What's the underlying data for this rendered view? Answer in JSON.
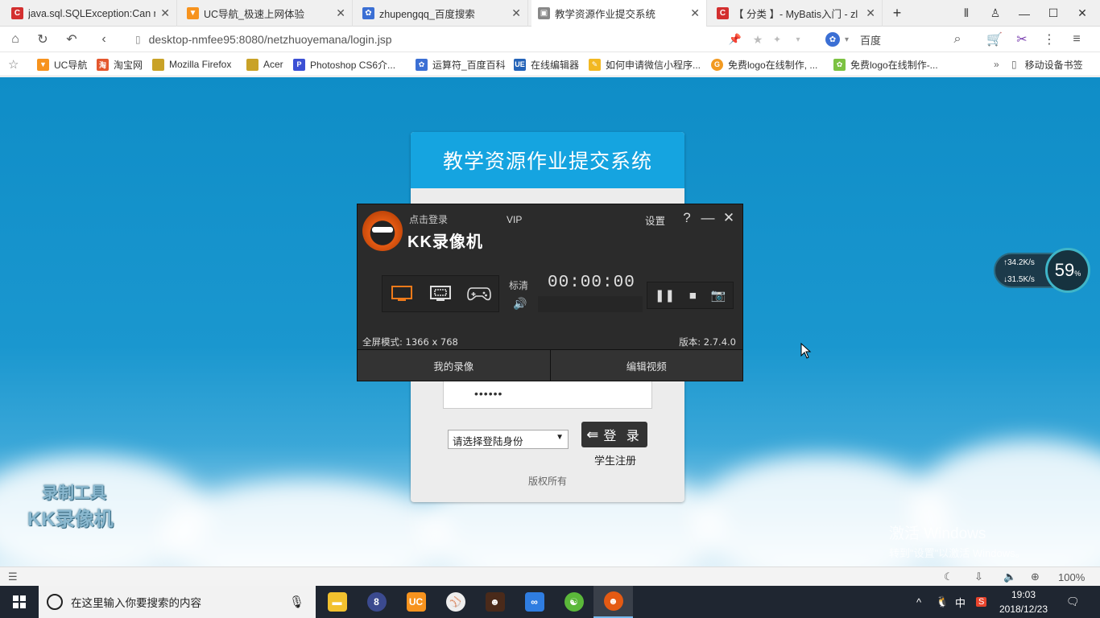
{
  "browser": {
    "tabs": [
      {
        "label": "java.sql.SQLException:Can n",
        "icon": "c-icon",
        "color": "#d32f2f"
      },
      {
        "label": "UC导航_极速上网体验",
        "icon": "uc-icon",
        "color": "#f7931e"
      },
      {
        "label": "zhupengqq_百度搜索",
        "icon": "baidu-paw-icon",
        "color": "#3b6fd4"
      },
      {
        "label": "教学资源作业提交系统",
        "icon": "page-icon",
        "color": "#888888"
      },
      {
        "label": "【 分类 】- MyBatis入门 - zl",
        "icon": "c-icon",
        "color": "#d32f2f"
      }
    ],
    "url": "desktop-nmfee95:8080/netzhuoyemana/login.jsp",
    "search_engine": "百度",
    "bookmarks": [
      {
        "label": "UC导航",
        "color": "#f7931e"
      },
      {
        "label": "淘宝网",
        "color": "#e4572e"
      },
      {
        "label": "Mozilla Firefox",
        "color": "#c9a227"
      },
      {
        "label": "Acer",
        "color": "#c9a227"
      },
      {
        "label": "Photoshop CS6介...",
        "color": "#3b4fd4"
      },
      {
        "label": "运算符_百度百科",
        "color": "#3b6fd4"
      },
      {
        "label": "在线编辑器",
        "color": "#2463b8"
      },
      {
        "label": "如何申请微信小程序...",
        "color": "#f2b822"
      },
      {
        "label": "免费logo在线制作, ...",
        "color": "#f29a22"
      },
      {
        "label": "免费logo在线制作-...",
        "color": "#7cc242"
      }
    ],
    "more_bookmarks": "»",
    "mobile_bookmarks": "移动设备书签",
    "zoom": "100%"
  },
  "login": {
    "title": "教学资源作业提交系统",
    "password_masked": "••••••",
    "role_select": "请选择登陆身份",
    "login_button": "登 录",
    "register_link": "学生注册",
    "copyright": "版权所有"
  },
  "kk": {
    "login_link": "点击登录",
    "vip": "VIP",
    "title": "KK录像机",
    "settings": "设置",
    "help": "?",
    "quality": "标清",
    "timer": "00:00:00",
    "mode_label": "全屏模式: 1366 x 768",
    "version": "版本: 2.7.4.0",
    "my_videos": "我的录像",
    "edit_video": "编辑视频"
  },
  "speed": {
    "upload": "↑34.2K/s",
    "download": "↓31.5K/s",
    "percent": "59",
    "unit": "%"
  },
  "watermark": {
    "line1": "录制工具",
    "line2": "KK录像机"
  },
  "activate": {
    "line1": "激活 Windows",
    "line2": "转到\"设置\"以激活 Windows。"
  },
  "taskbar": {
    "search_placeholder": "在这里输入你要搜索的内容",
    "ime": "中",
    "time": "19:03",
    "date": "2018/12/23"
  }
}
